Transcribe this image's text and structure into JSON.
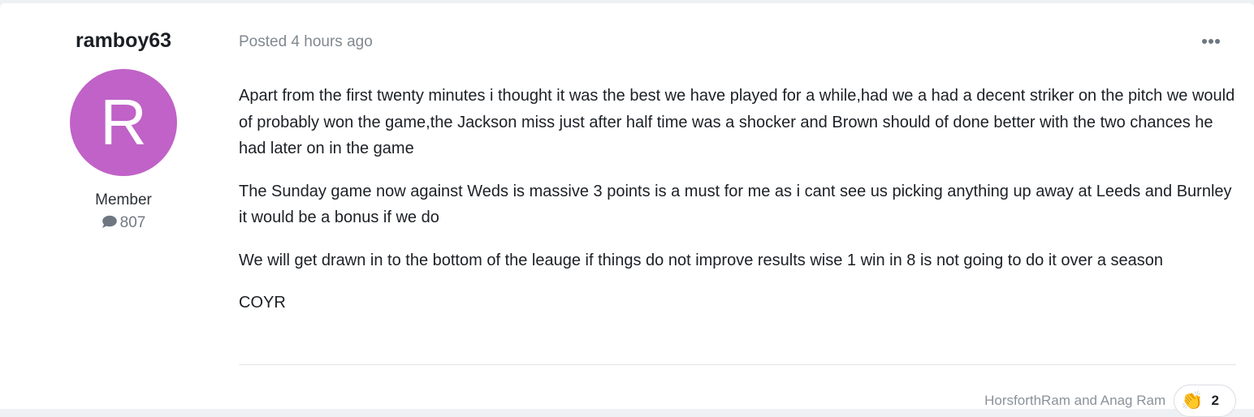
{
  "author": {
    "username": "ramboy63",
    "avatar_letter": "R",
    "avatar_color": "#c062c7",
    "member_title": "Member",
    "post_count": "807",
    "post_count_icon": "comment-icon"
  },
  "post": {
    "posted": "Posted 4 hours ago",
    "more_icon": "ellipsis-icon",
    "paragraphs": [
      "Apart from the first twenty minutes i thought it was the best we have played for a while,had we a had a decent striker on the pitch we would of probably won the game,the Jackson miss just after half time was a shocker and Brown should of done better with the two chances he had later on in the game",
      "The Sunday game now against Weds is massive 3 points is a must for me as i cant see us picking anything up away at Leeds and Burnley it would be a bonus if we do",
      "We will get drawn in to the bottom of the leauge if things do not improve results wise 1 win in 8 is not going to do it over a season",
      "COYR"
    ]
  },
  "reactions": {
    "reacted_by": "HorsforthRam and Anag Ram",
    "icon": "clapping-hands-icon",
    "count": "2"
  }
}
